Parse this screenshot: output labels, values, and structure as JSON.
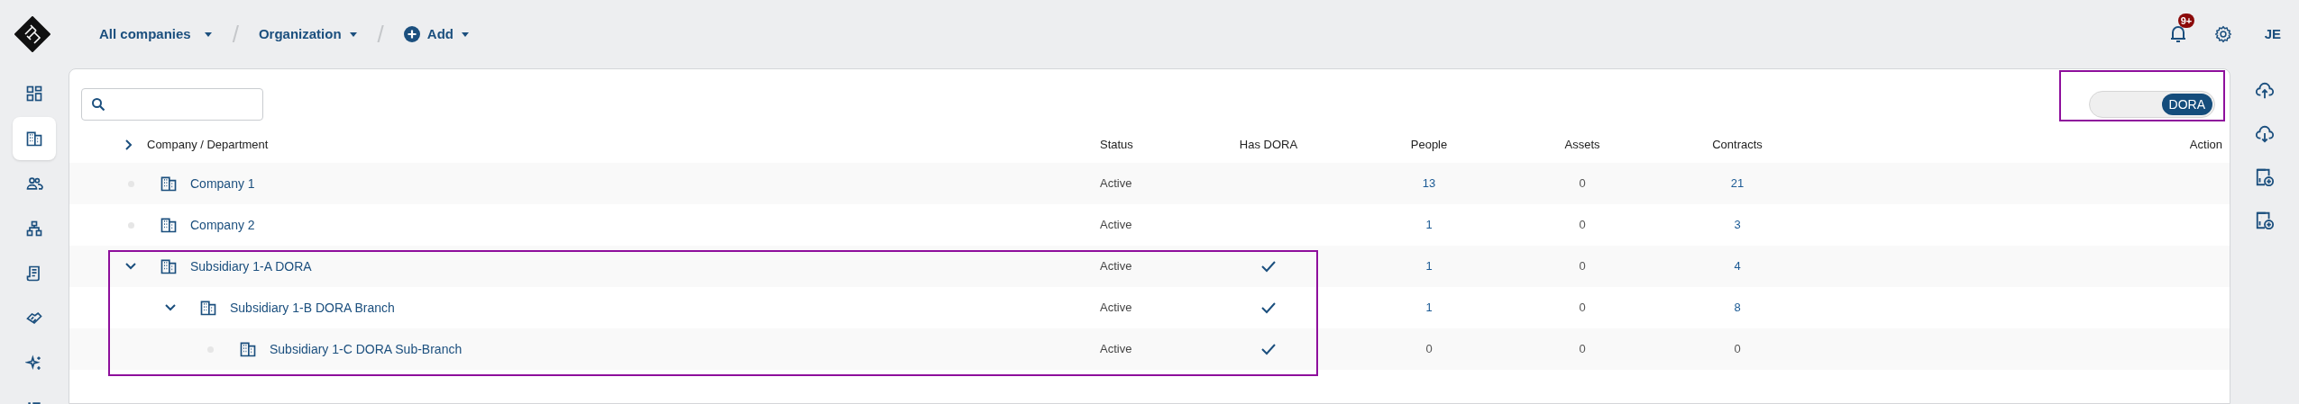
{
  "header": {
    "nav": [
      {
        "label": "All companies",
        "kind": "dropdown"
      },
      {
        "separator": "/",
        "label": "Organization",
        "kind": "dropdown"
      },
      {
        "separator": "/",
        "label": "Add",
        "kind": "add"
      }
    ],
    "notifications_badge": "9+",
    "avatar": "JE"
  },
  "sidebar": {
    "items": [
      {
        "selected": false
      },
      {
        "selected": true
      },
      {
        "selected": false
      },
      {
        "selected": false
      },
      {
        "selected": false
      },
      {
        "selected": false
      },
      {
        "selected": false
      },
      {
        "selected": false
      }
    ]
  },
  "toolbar": {
    "dora_toggle": {
      "label": "DORA",
      "on": true
    }
  },
  "table": {
    "expand_all": {
      "expanded": false
    },
    "columns": [
      "Company / Department",
      "Status",
      "Has DORA",
      "People",
      "Assets",
      "Contracts",
      "Action"
    ],
    "rows": [
      {
        "name": "Company 1",
        "status": "Active",
        "has_dora": false,
        "people": {
          "text": "13",
          "link": true
        },
        "assets": {
          "text": "0",
          "link": false
        },
        "contracts": {
          "text": "21",
          "link": true
        }
      },
      {
        "name": "Company 2",
        "status": "Active",
        "has_dora": false,
        "people": {
          "text": "1",
          "link": true
        },
        "assets": {
          "text": "0",
          "link": false
        },
        "contracts": {
          "text": "3",
          "link": true
        }
      },
      {
        "name": "Subsidiary 1-A DORA",
        "status": "Active",
        "has_dora": true,
        "people": {
          "text": "1",
          "link": true
        },
        "assets": {
          "text": "0",
          "link": false
        },
        "contracts": {
          "text": "4",
          "link": true
        },
        "expanded": true,
        "children": [
          {
            "name": "Subsidiary 1-B DORA Branch",
            "status": "Active",
            "has_dora": true,
            "people": {
              "text": "1",
              "link": true
            },
            "assets": {
              "text": "0",
              "link": false
            },
            "contracts": {
              "text": "8",
              "link": true
            },
            "expanded": true,
            "children": [
              {
                "name": "Subsidiary 1-C DORA Sub-Branch",
                "status": "Active",
                "has_dora": true,
                "people": {
                  "text": "0",
                  "link": false
                },
                "assets": {
                  "text": "0",
                  "link": false
                },
                "contracts": {
                  "text": "0",
                  "link": false
                }
              }
            ]
          }
        ]
      }
    ]
  }
}
